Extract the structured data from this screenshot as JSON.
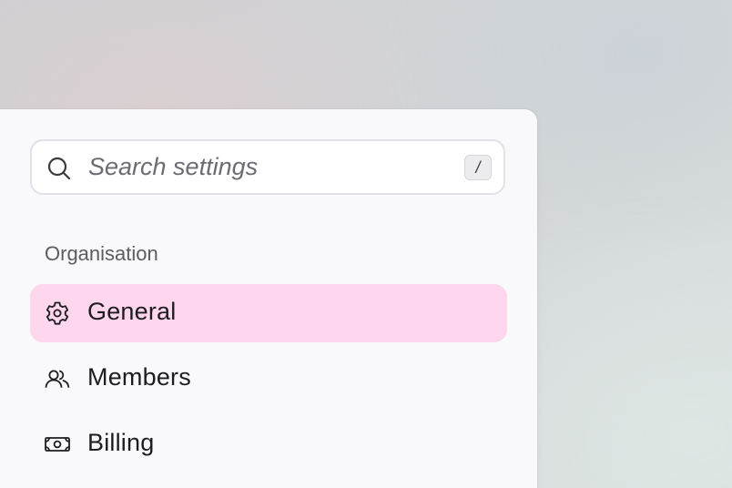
{
  "search": {
    "placeholder": "Search settings",
    "value": "",
    "shortcut_key": "/",
    "icon": "search-icon"
  },
  "sidebar": {
    "section_label": "Organisation",
    "active_color": "#fed6ee",
    "items": [
      {
        "label": "General",
        "icon": "gear-icon",
        "active": true
      },
      {
        "label": "Members",
        "icon": "users-icon",
        "active": false
      },
      {
        "label": "Billing",
        "icon": "banknote-icon",
        "active": false
      }
    ]
  }
}
